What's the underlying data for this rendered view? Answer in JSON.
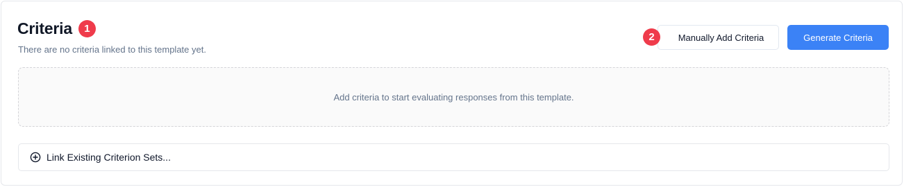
{
  "header": {
    "title": "Criteria",
    "title_badge": "1",
    "subtitle": "There are no criteria linked to this template yet."
  },
  "actions": {
    "manual_badge": "2",
    "manual_add_label": "Manually Add Criteria",
    "generate_label": "Generate Criteria"
  },
  "empty_state": {
    "message": "Add criteria to start evaluating responses from this template."
  },
  "link_existing": {
    "label": "Link Existing Criterion Sets...",
    "icon": "plus-circle-icon"
  },
  "colors": {
    "badge": "#ef3b4b",
    "primary": "#3b82f6"
  }
}
